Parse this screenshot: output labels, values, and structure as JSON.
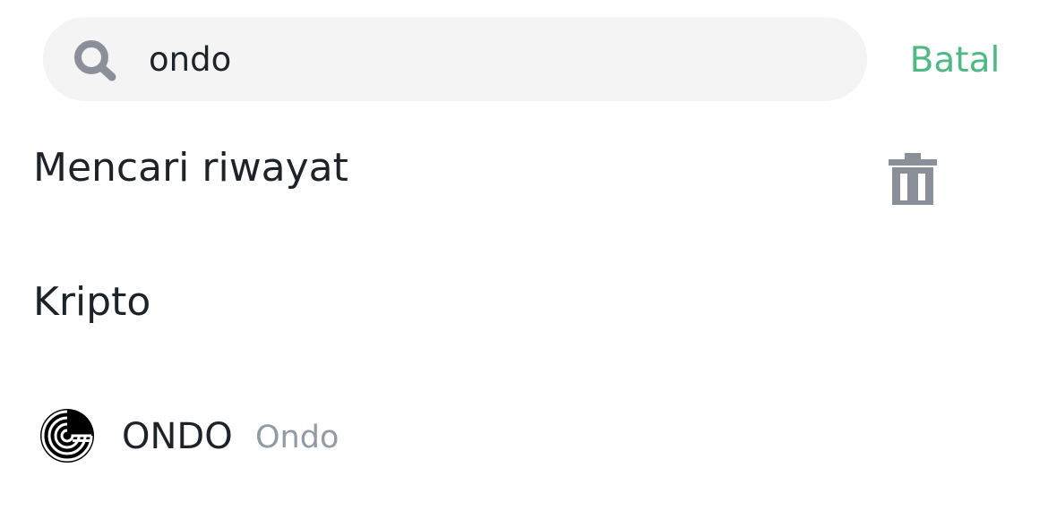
{
  "search": {
    "value": "ondo",
    "cancel_label": "Batal"
  },
  "history": {
    "title": "Mencari riwayat"
  },
  "crypto": {
    "title": "Kripto",
    "results": [
      {
        "symbol": "ONDO",
        "name": "Ondo"
      }
    ]
  },
  "colors": {
    "accent": "#4fb985",
    "text_primary": "#1e2329",
    "text_secondary": "#929aa5",
    "search_bg": "#f4f4f4",
    "icon_gray": "#8a8f99"
  },
  "icons": {
    "search": "search-icon",
    "delete_history": "trash-icon",
    "coin_logo": "ondo-logo-icon"
  }
}
